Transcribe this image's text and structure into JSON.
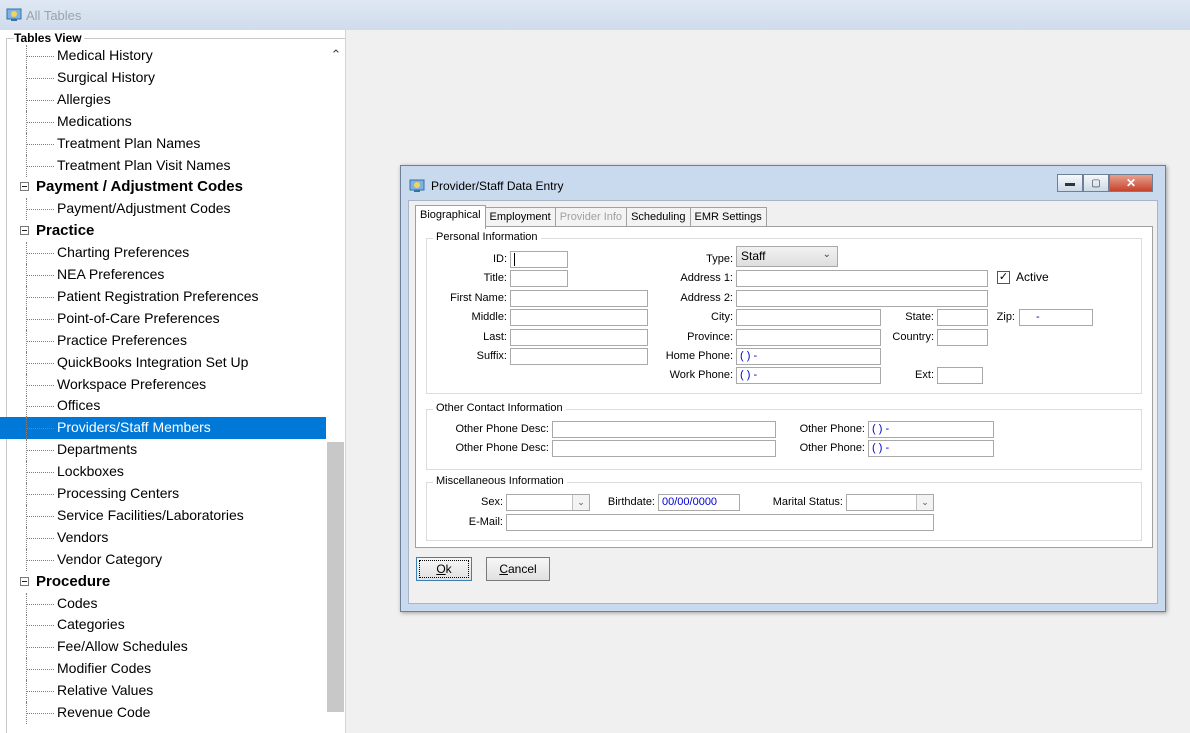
{
  "window": {
    "title": "All Tables"
  },
  "tree": {
    "title": "Tables View",
    "items": [
      {
        "kind": "leaf",
        "label": "Medical History"
      },
      {
        "kind": "leaf",
        "label": "Surgical History"
      },
      {
        "kind": "leaf",
        "label": "Allergies"
      },
      {
        "kind": "leaf",
        "label": "Medications"
      },
      {
        "kind": "leaf",
        "label": "Treatment Plan Names"
      },
      {
        "kind": "leaf",
        "label": "Treatment Plan Visit Names"
      },
      {
        "kind": "group",
        "label": "Payment / Adjustment Codes"
      },
      {
        "kind": "leaf",
        "label": "Payment/Adjustment Codes"
      },
      {
        "kind": "group",
        "label": "Practice"
      },
      {
        "kind": "leaf",
        "label": "Charting Preferences"
      },
      {
        "kind": "leaf",
        "label": "NEA Preferences"
      },
      {
        "kind": "leaf",
        "label": "Patient Registration Preferences"
      },
      {
        "kind": "leaf",
        "label": "Point-of-Care Preferences"
      },
      {
        "kind": "leaf",
        "label": "Practice Preferences"
      },
      {
        "kind": "leaf",
        "label": "QuickBooks Integration Set Up"
      },
      {
        "kind": "leaf",
        "label": "Workspace Preferences"
      },
      {
        "kind": "leaf",
        "label": "Offices"
      },
      {
        "kind": "leaf",
        "label": "Providers/Staff Members",
        "selected": true
      },
      {
        "kind": "leaf",
        "label": "Departments"
      },
      {
        "kind": "leaf",
        "label": "Lockboxes"
      },
      {
        "kind": "leaf",
        "label": "Processing Centers"
      },
      {
        "kind": "leaf",
        "label": "Service Facilities/Laboratories"
      },
      {
        "kind": "leaf",
        "label": "Vendors"
      },
      {
        "kind": "leaf",
        "label": "Vendor Category"
      },
      {
        "kind": "group",
        "label": "Procedure"
      },
      {
        "kind": "leaf",
        "label": "Codes"
      },
      {
        "kind": "leaf",
        "label": "Categories"
      },
      {
        "kind": "leaf",
        "label": "Fee/Allow Schedules"
      },
      {
        "kind": "leaf",
        "label": "Modifier Codes"
      },
      {
        "kind": "leaf",
        "label": "Relative Values"
      },
      {
        "kind": "leaf",
        "label": "Revenue Code"
      }
    ]
  },
  "dialog": {
    "title": "Provider/Staff Data Entry",
    "tabs": [
      "Biographical",
      "Employment",
      "Provider Info",
      "Scheduling",
      "EMR Settings"
    ],
    "personal": {
      "legend": "Personal Information",
      "id_label": "ID:",
      "title_label": "Title:",
      "first_label": "First Name:",
      "middle_label": "Middle:",
      "last_label": "Last:",
      "suffix_label": "Suffix:",
      "type_label": "Type:",
      "type_value": "Staff",
      "address1_label": "Address 1:",
      "address2_label": "Address 2:",
      "city_label": "City:",
      "province_label": "Province:",
      "home_phone_label": "Home Phone:",
      "home_phone_value": "(   )    -",
      "work_phone_label": "Work Phone:",
      "work_phone_value": "(   )    -",
      "state_label": "State:",
      "country_label": "Country:",
      "zip_label": "Zip:",
      "zip_value": "-",
      "ext_label": "Ext:",
      "active_label": "Active",
      "active_check": "✓"
    },
    "other_contact": {
      "legend": "Other Contact Information",
      "desc1_label": "Other Phone Desc:",
      "desc2_label": "Other Phone Desc:",
      "phone1_label": "Other Phone:",
      "phone1_value": "(   )    -",
      "phone2_label": "Other Phone:",
      "phone2_value": "(   )    -"
    },
    "misc": {
      "legend": "Miscellaneous Information",
      "sex_label": "Sex:",
      "birthdate_label": "Birthdate:",
      "birthdate_value": "00/00/0000",
      "marital_label": "Marital Status:",
      "email_label": "E-Mail:"
    },
    "buttons": {
      "ok_mnemonic": "O",
      "ok_rest": "k",
      "cancel_mnemonic": "C",
      "cancel_rest": "ancel"
    },
    "window_buttons": {
      "minimize": "▬",
      "maximize": "▢",
      "close": "✕"
    }
  }
}
